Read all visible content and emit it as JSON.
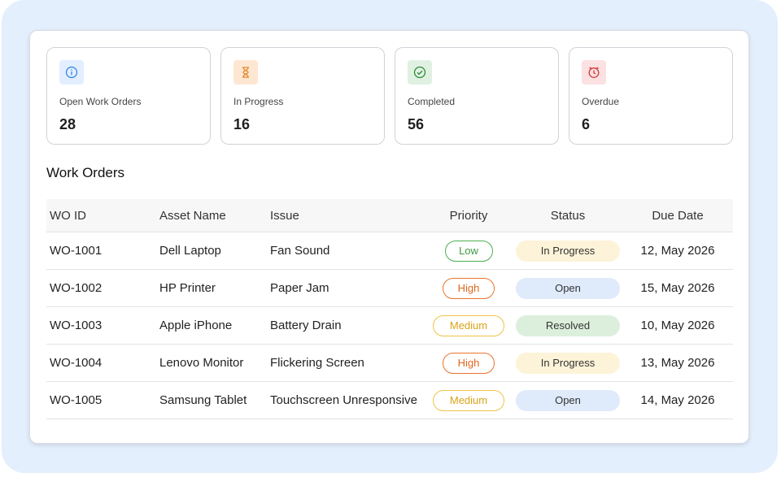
{
  "stats": [
    {
      "label": "Open Work Orders",
      "value": "28",
      "icon": "info-icon",
      "icon_bg": "#e3efff",
      "icon_color": "#2b7de9"
    },
    {
      "label": "In Progress",
      "value": "16",
      "icon": "hourglass-icon",
      "icon_bg": "#fde7d2",
      "icon_color": "#e0892e"
    },
    {
      "label": "Completed",
      "value": "56",
      "icon": "check-circle-icon",
      "icon_bg": "#e0f1e2",
      "icon_color": "#2e8b3a"
    },
    {
      "label": "Overdue",
      "value": "6",
      "icon": "alarm-clock-icon",
      "icon_bg": "#fbe1e1",
      "icon_color": "#d13b3b"
    }
  ],
  "section_title": "Work Orders",
  "table": {
    "headers": {
      "id": "WO ID",
      "asset": "Asset Name",
      "issue": "Issue",
      "priority": "Priority",
      "status": "Status",
      "due": "Due Date"
    },
    "rows": [
      {
        "id": "WO-1001",
        "asset": "Dell Laptop",
        "issue": "Fan Sound",
        "priority": "Low",
        "status": "In Progress",
        "due": "12, May 2026"
      },
      {
        "id": "WO-1002",
        "asset": "HP Printer",
        "issue": "Paper Jam",
        "priority": "High",
        "status": "Open",
        "due": "15, May 2026"
      },
      {
        "id": "WO-1003",
        "asset": "Apple iPhone",
        "issue": "Battery Drain",
        "priority": "Medium",
        "status": "Resolved",
        "due": "10, May 2026"
      },
      {
        "id": "WO-1004",
        "asset": "Lenovo Monitor",
        "issue": "Flickering Screen",
        "priority": "High",
        "status": "In Progress",
        "due": "13, May 2026"
      },
      {
        "id": "WO-1005",
        "asset": "Samsung Tablet",
        "issue": "Touchscreen Unresponsive",
        "priority": "Medium",
        "status": "Open",
        "due": "14, May 2026"
      }
    ]
  }
}
